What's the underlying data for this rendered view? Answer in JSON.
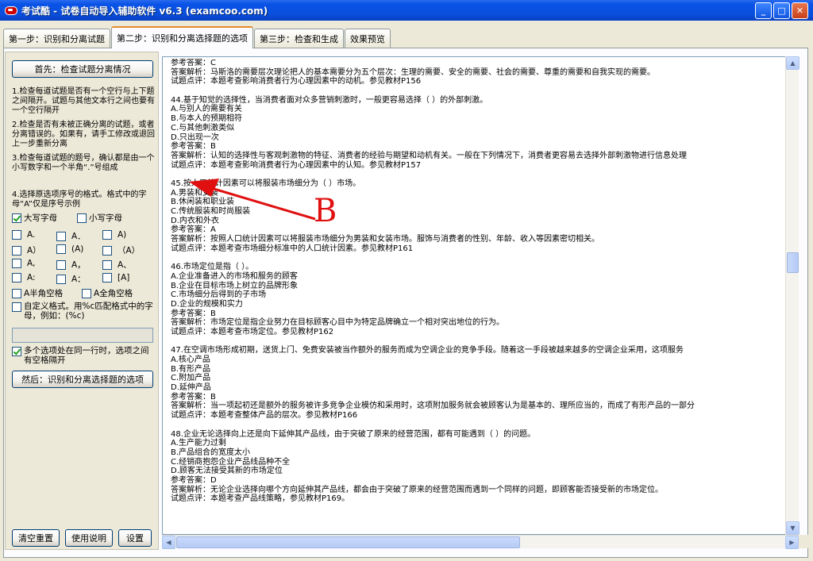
{
  "window": {
    "title": "考试酷 - 试卷自动导入辅助软件 v6.3 (examcoo.com)",
    "minimize": "_",
    "maximize": "□",
    "close": "✕"
  },
  "tabs": [
    {
      "label": "第一步：识别和分离试题"
    },
    {
      "label": "第二步：识别和分离选择题的选项"
    },
    {
      "label": "第三步：检查和生成"
    },
    {
      "label": "效果预览"
    }
  ],
  "left": {
    "check_button": "首先：检查试题分离情况",
    "hint1": "1.检查每道试题是否有一个空行与上下题之间隔开。试题与其他文本行之间也要有一个空行隔开",
    "hint2": "2.检查是否有未被正确分离的试题，或者分离错误的。如果有，请手工修改或退回上一步重新分离",
    "hint3": "3.检查每道试题的题号，确认都是由一个小写数字和一个半角“.”号组成",
    "hint4": "4.选择原选项序号的格式。格式中的字母“A”仅是序号示例",
    "upper_label": "大写字母",
    "lower_label": "小写字母",
    "formats": [
      "A.",
      "A．",
      "A)",
      "A）",
      "(A)",
      "（A）",
      "A,",
      "A，",
      "A、",
      "A:",
      "A：",
      "[A]"
    ],
    "half_space": "A半角空格",
    "full_space": "A全角空格",
    "custom_label": "自定义格式。用%c匹配格式中的字母，例如：(%c)",
    "multi_label": "多个选项处在同一行时，选项之间有空格隔开",
    "then_button": "然后：识别和分离选择题的选项",
    "clear_button": "清空重置",
    "help_button": "使用说明",
    "settings_button": "设置"
  },
  "content": {
    "lines": [
      "参考答案：C",
      "答案解析：马斯洛的需要层次理论把人的基本需要分为五个层次：生理的需要、安全的需要、社会的需要、尊重的需要和自我实现的需要。",
      "试题点评：本题考查影响消费者行为心理因素中的动机。参见教材P156",
      "",
      "44.基于知觉的选择性，当消费者面对众多营销刺激时，一般更容易选择（   ）的外部刺激。",
      "A.与别人的需要有关",
      "B.与本人的预期相符",
      "C.与其他刺激类似",
      "D.只出现一次",
      "参考答案：B",
      "答案解析：认知的选择性与客观刺激物的特征、消费者的经验与期望和动机有关。一般在下列情况下，消费者更容易去选择外部刺激物进行信息处理",
      "试题点评：本题考查影响消费者行为心理因素中的认知。参见教材P157",
      "",
      "45.按人口统计因素可以将服装市场细分为（   ）市场。",
      "A.男装和女装",
      "B.休闲装和职业装",
      "C.传统服装和时尚服装",
      "D.内衣和外衣",
      "参考答案：A",
      "答案解析：按照人口统计因素可以将服装市场细分为男装和女装市场。服饰与消费者的性别、年龄、收入等因素密切相关。",
      "试题点评：本题考查市场细分标准中的人口统计因素。参见教材P161",
      "",
      "46.市场定位是指（   ）。",
      "A.企业准备进入的市场和服务的顾客",
      "B.企业在目标市场上树立的品牌形象",
      "C.市场细分后得到的子市场",
      "D.企业的规模和实力",
      "参考答案：B",
      "答案解析：市场定位是指企业努力在目标顾客心目中为特定品牌确立一个相对突出地位的行为。",
      "试题点评：本题考查市场定位。参见教材P162",
      "",
      "47.在空调市场形成初期，送货上门、免费安装被当作额外的服务而成为空调企业的竞争手段。随着这一手段被越来越多的空调企业采用，这项服务",
      "A.核心产品",
      "B.有形产品",
      "C.附加产品",
      "D.延伸产品",
      "参考答案：B",
      "答案解析：当一项起初还是额外的服务被许多竞争企业模仿和采用时，这项附加服务就会被顾客认为是基本的、理所应当的，而成了有形产品的一部分",
      "试题点评：本题考查整体产品的层次。参见教材P166",
      "",
      "48.企业无论选择向上还是向下延伸其产品线，由于突破了原来的经营范围，都有可能遇到（   ）的问题。",
      "A.生产能力过剩",
      "B.产品组合的宽度太小",
      "C.经销商抱怨企业产品线品种不全",
      "D.顾客无法接受其新的市场定位",
      "参考答案：D",
      "答案解析：无论企业选择向哪个方向延伸其产品线，都会由于突破了原来的经营范围而遇到一个同样的问题，即顾客能否接受新的市场定位。",
      "试题点评：本题考查产品线策略，参见教材P169。"
    ]
  },
  "annotation": {
    "label": "B",
    "color": "#e01010"
  }
}
